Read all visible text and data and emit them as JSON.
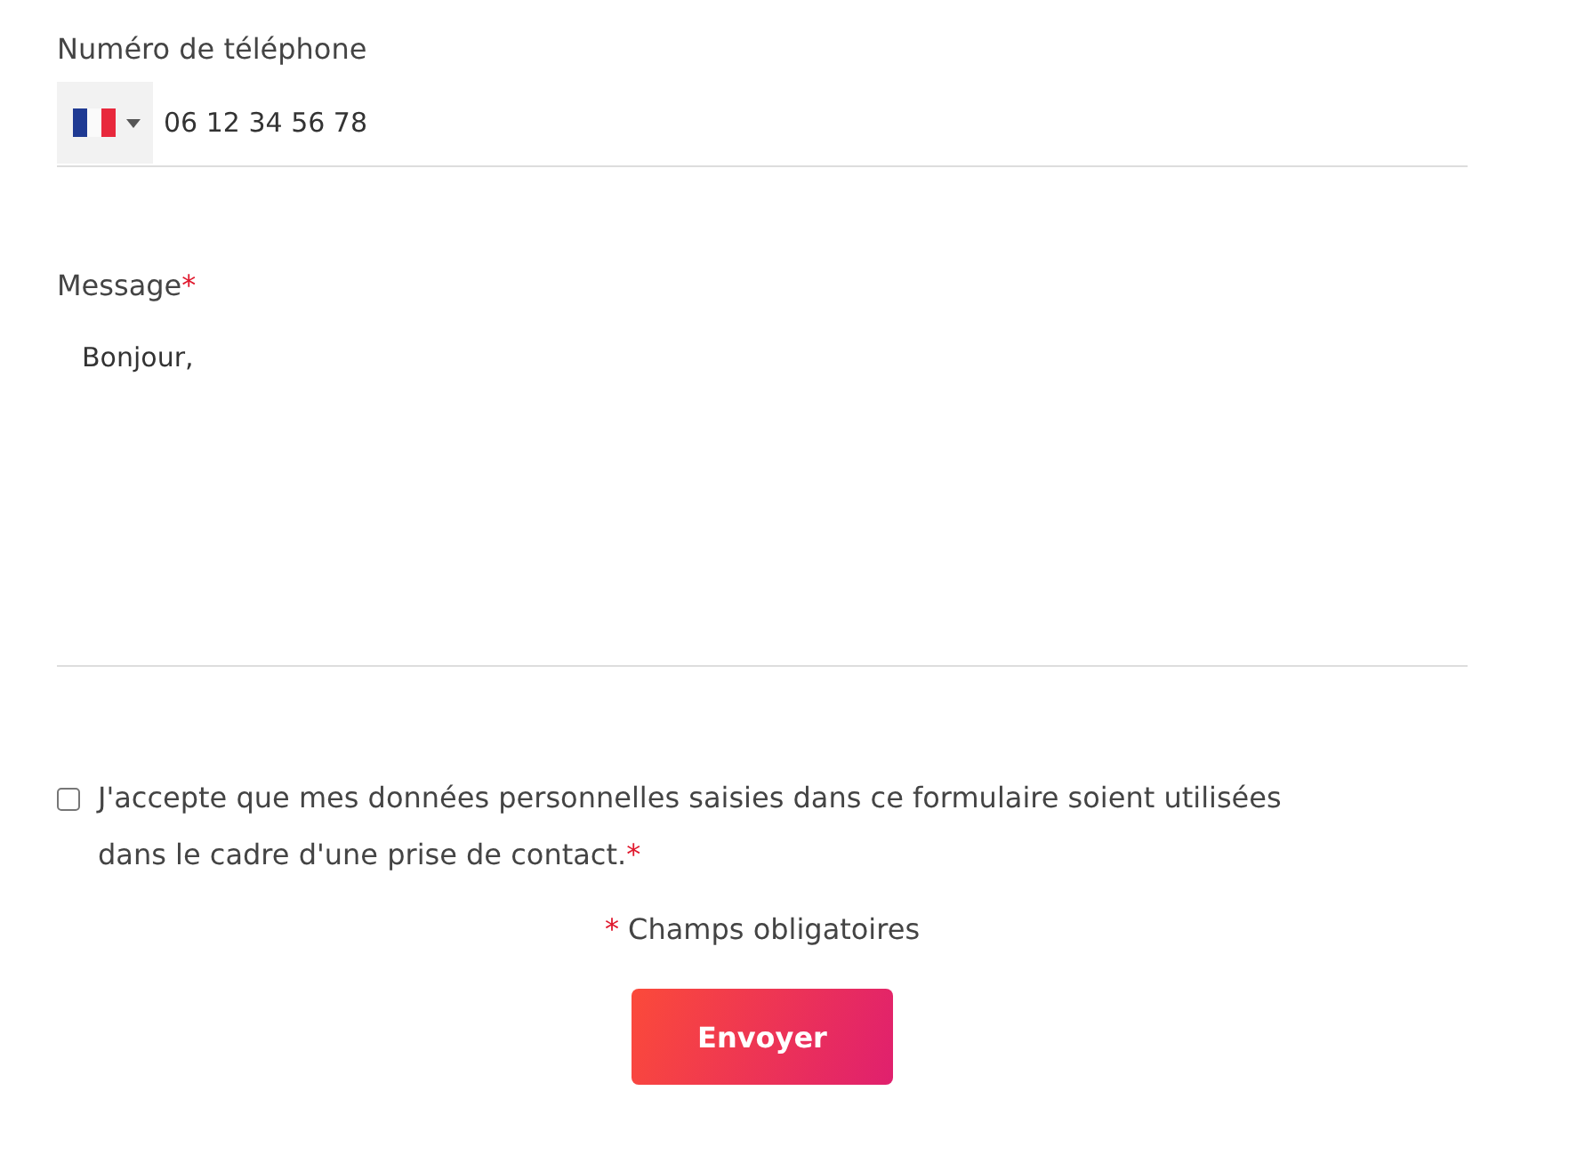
{
  "phone": {
    "label": "Numéro de téléphone",
    "value": "06 12 34 56 78"
  },
  "message": {
    "label": "Message",
    "required_mark": "*",
    "value": "Bonjour,"
  },
  "consent": {
    "checked": false,
    "text": "J'accepte que mes données personnelles saisies dans ce formulaire soient utilisées dans le cadre d'une prise de contact.",
    "required_mark": "*"
  },
  "required_note": {
    "mark": "*",
    "text": "Champs obligatoires"
  },
  "submit": {
    "label": "Envoyer"
  }
}
